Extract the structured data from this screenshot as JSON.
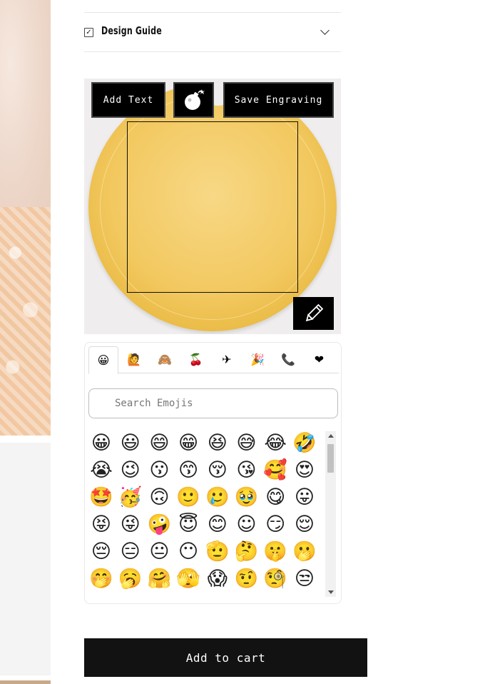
{
  "accordion": {
    "title": "Design Guide",
    "check_glyph": "✓"
  },
  "toolbar": {
    "add_text_label": "Add Text",
    "bomb_icon": "bomb-icon",
    "save_label": "Save Engraving",
    "edit_icon": "pencil-icon"
  },
  "picker": {
    "tabs": [
      {
        "icon": "smileys-icon",
        "glyph": "😀",
        "active": true
      },
      {
        "icon": "people-icon",
        "glyph": "🙋",
        "active": false
      },
      {
        "icon": "animals-icon",
        "glyph": "🙈",
        "active": false
      },
      {
        "icon": "food-icon",
        "glyph": "🍒",
        "active": false
      },
      {
        "icon": "travel-icon",
        "glyph": "✈",
        "active": false
      },
      {
        "icon": "activities-icon",
        "glyph": "🎉",
        "active": false
      },
      {
        "icon": "objects-icon",
        "glyph": "📞",
        "active": false
      },
      {
        "icon": "symbols-icon",
        "glyph": "❤",
        "active": false
      }
    ],
    "search_placeholder": "Search Emojis",
    "emojis": [
      "😀",
      "😃",
      "😄",
      "😁",
      "😆",
      "😅",
      "😂",
      "🤣",
      "😭",
      "😉",
      "😗",
      "😙",
      "😚",
      "😘",
      "🥰",
      "😍",
      "🤩",
      "🥳",
      "🙃",
      "🙂",
      "🥲",
      "🥹",
      "😋",
      "😛",
      "😝",
      "😜",
      "🤪",
      "😇",
      "😊",
      "☺",
      "😏",
      "😌",
      "😔",
      "😑",
      "😐",
      "😶",
      "🫡",
      "🤔",
      "🤫",
      "🫢",
      "🤭",
      "🥱",
      "🤗",
      "🫣",
      "😱",
      "🤨",
      "🧐",
      "😒"
    ]
  },
  "cart": {
    "label": "Add to cart"
  }
}
